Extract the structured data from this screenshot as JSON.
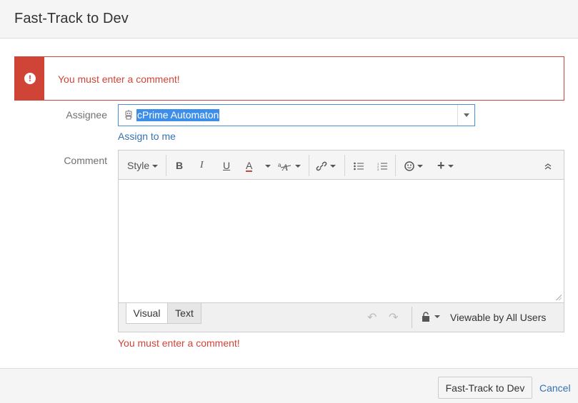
{
  "dialog": {
    "title": "Fast-Track to Dev"
  },
  "alert": {
    "message": "You must enter a comment!",
    "icon": "error-icon",
    "color": "#d04437"
  },
  "assignee": {
    "label": "Assignee",
    "value": "cPrime Automaton",
    "assign_to_me": "Assign to me"
  },
  "comment": {
    "label": "Comment",
    "toolbar": {
      "style_label": "Style",
      "bold": "B",
      "italic": "I",
      "underline": "U",
      "text_color": "A"
    },
    "tabs": [
      {
        "label": "Visual",
        "active": true
      },
      {
        "label": "Text",
        "active": false
      }
    ],
    "visibility": "Viewable by All Users",
    "error": "You must enter a comment!"
  },
  "footer": {
    "submit_label": "Fast-Track to Dev",
    "cancel_label": "Cancel"
  },
  "colors": {
    "accent": "#3572b0",
    "error": "#d04437",
    "selection": "#3d8ee8"
  }
}
